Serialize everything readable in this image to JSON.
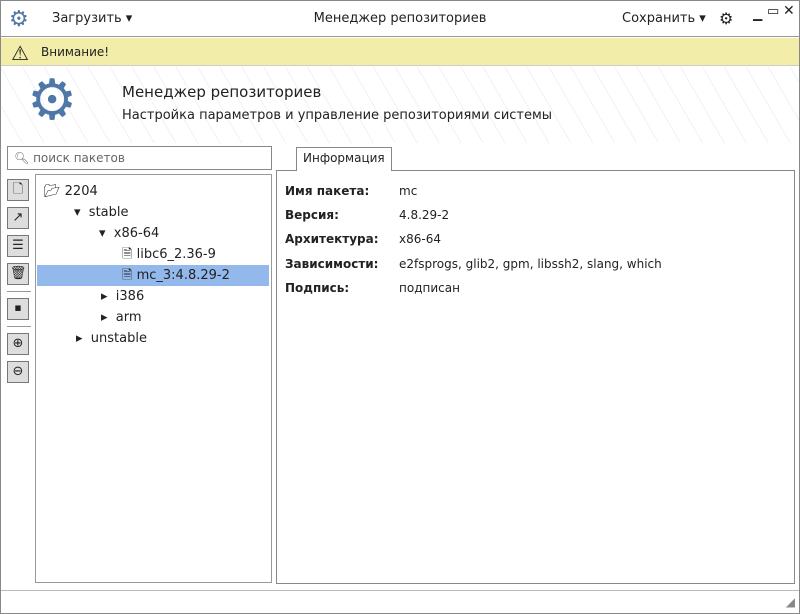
{
  "titlebar": {
    "title": "Менеджер репозиториев",
    "load_menu": "Загрузить",
    "save_menu": "Сохранить"
  },
  "warning": {
    "text": "Внимание!"
  },
  "banner": {
    "title": "Менеджер репозиториев",
    "subtitle": "Настройка параметров и управление репозиториями системы"
  },
  "search": {
    "placeholder": "поиск пакетов"
  },
  "tree": {
    "root": "2204",
    "stable": "stable",
    "x86": "x86-64",
    "pkg1": "libc6_2.36-9",
    "pkg2": "mc_3:4.8.29-2",
    "i386": "i386",
    "arm": "arm",
    "unstable": "unstable"
  },
  "tab": "Информация",
  "info": [
    {
      "k": "Имя пакета:",
      "v": "mc"
    },
    {
      "k": "Версия:",
      "v": "4.8.29-2"
    },
    {
      "k": "Архитектура:",
      "v": "x86-64"
    },
    {
      "k": "Зависимости:",
      "v": "e2fsprogs, glib2, gpm, libssh2, slang, which"
    },
    {
      "k": "Подпись:",
      "v": "подписан"
    }
  ]
}
